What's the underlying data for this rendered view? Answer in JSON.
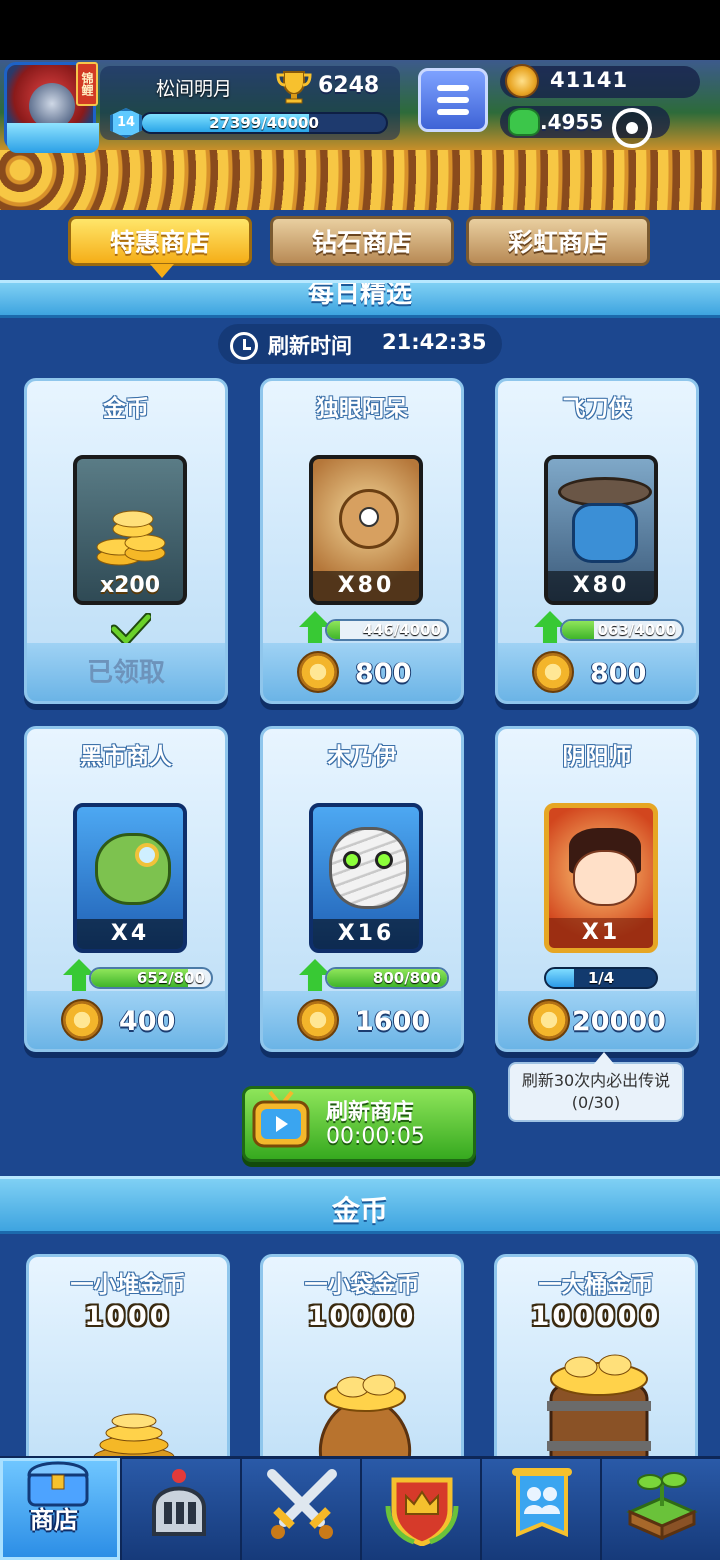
{
  "header": {
    "tag": "锦鲤",
    "player_name": "松间明月",
    "trophies": "6248",
    "level": "14",
    "xp_text": "27399/40000",
    "xp_fraction": 0.685,
    "gold": "41141",
    "gems": ".4955"
  },
  "tabs": [
    {
      "label": "特惠商店",
      "active": true
    },
    {
      "label": "钻石商店",
      "active": false
    },
    {
      "label": "彩虹商店",
      "active": false
    }
  ],
  "daily": {
    "banner": "每日精选",
    "refresh_label": "刷新时间",
    "refresh_time": "21:42:35"
  },
  "cards": [
    {
      "name": "金币",
      "qty": "x200",
      "claimed": "已领取"
    },
    {
      "name": "独眼阿呆",
      "qty": "X80",
      "progress": "446/4000",
      "progress_fraction": 0.11,
      "price": "800"
    },
    {
      "name": "飞刀侠",
      "qty": "X80",
      "progress": "063/4000",
      "progress_fraction": 0.27,
      "price": "800"
    },
    {
      "name": "黑市商人",
      "qty": "X4",
      "progress": "652/800",
      "progress_fraction": 0.81,
      "price": "400"
    },
    {
      "name": "木乃伊",
      "qty": "X16",
      "progress": "800/800",
      "progress_fraction": 1.0,
      "price": "1600"
    },
    {
      "name": "阴阳师",
      "qty": "X1",
      "progress": "1/4",
      "progress_fraction": 0.25,
      "price": "20000"
    }
  ],
  "refresh_button": {
    "label": "刷新商店",
    "time": "00:00:05"
  },
  "tooltip": {
    "line1": "刷新30次内必出传说",
    "line2": "(0/30)"
  },
  "coins_section": {
    "title": "金币",
    "items": [
      {
        "name": "一小堆金币",
        "amount": "1000"
      },
      {
        "name": "一小袋金币",
        "amount": "10000"
      },
      {
        "name": "一大桶金币",
        "amount": "100000"
      }
    ]
  },
  "bottom_nav": [
    {
      "label": "商店",
      "icon": "treasure-chest-icon",
      "active": true
    },
    {
      "label": "",
      "icon": "knight-helmet-icon",
      "active": false
    },
    {
      "label": "",
      "icon": "crossed-swords-icon",
      "active": false
    },
    {
      "label": "",
      "icon": "crown-shield-icon",
      "active": false
    },
    {
      "label": "",
      "icon": "team-banner-icon",
      "active": false
    },
    {
      "label": "",
      "icon": "sprout-island-icon",
      "active": false
    }
  ],
  "colors": {
    "main_bg": "#1c478f",
    "tab_active": "#f5ae18",
    "tab_inactive": "#b88a55",
    "refresh_green": "#36a91f"
  }
}
